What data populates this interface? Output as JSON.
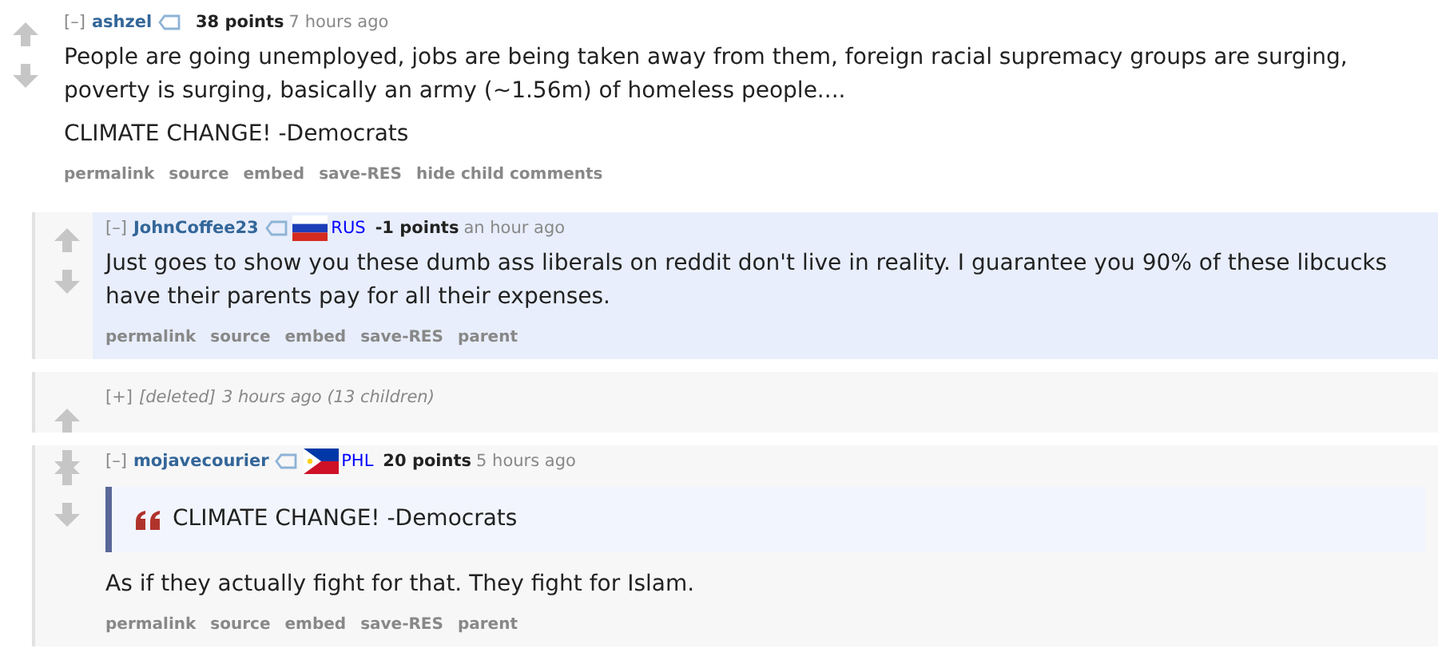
{
  "comments": [
    {
      "toggle": "[–]",
      "author": "ashzel",
      "points": "38 points",
      "time": "7 hours ago",
      "collapsed": false,
      "body": [
        {
          "kind": "paragraph",
          "text": "People are going unemployed, jobs are being taken away from them, foreign racial supremacy groups are surging, poverty is surging, basically an army (~1.56m) of homeless people...."
        },
        {
          "kind": "paragraph",
          "text": "CLIMATE CHANGE! -Democrats"
        }
      ],
      "actions": [
        "permalink",
        "source",
        "embed",
        "save-RES",
        "hide child comments"
      ],
      "children": [
        {
          "toggle": "[–]",
          "author": "JohnCoffee23",
          "flag": {
            "kind": "tricolor",
            "label": "RUS"
          },
          "points": "-1 points",
          "time": "an hour ago",
          "collapsed": false,
          "unread": true,
          "body": [
            {
              "kind": "paragraph",
              "text": "Just goes to show you these dumb ass liberals on reddit don't live in reality. I guarantee you 90% of these libcucks have their parents pay for all their expenses."
            }
          ],
          "actions": [
            "permalink",
            "source",
            "embed",
            "save-RES",
            "parent"
          ]
        },
        {
          "toggle": "[+]",
          "author": "[deleted]",
          "time": "3 hours ago",
          "children_count": "(13 children)",
          "collapsed": true,
          "unread": false
        },
        {
          "toggle": "[–]",
          "author": "mojavecourier",
          "flag": {
            "kind": "chevron",
            "label": "PHL"
          },
          "points": "20 points",
          "time": "5 hours ago",
          "collapsed": false,
          "unread": false,
          "body": [
            {
              "kind": "quote",
              "text": "CLIMATE CHANGE! -Democrats"
            },
            {
              "kind": "paragraph",
              "text": "As if they actually fight for that. They fight for Islam."
            }
          ],
          "actions": [
            "permalink",
            "source",
            "embed",
            "save-RES",
            "parent"
          ]
        }
      ]
    }
  ]
}
